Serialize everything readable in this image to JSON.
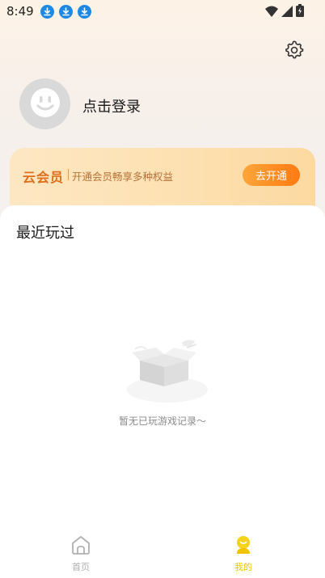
{
  "status_bar": {
    "time": "8:49",
    "icons": [
      "download-icon",
      "download-icon",
      "download-icon",
      "wifi-icon",
      "signal-icon",
      "battery-icon"
    ]
  },
  "header": {
    "settings_icon": "gear-icon"
  },
  "profile": {
    "avatar_icon": "smiley-avatar-icon",
    "login_label": "点击登录"
  },
  "member_card": {
    "title": "云会员",
    "description": "开通会员畅享多种权益",
    "button_label": "去开通"
  },
  "recent": {
    "title": "最近玩过",
    "empty_icon": "empty-box-icon",
    "empty_text": "暂无已玩游戏记录～"
  },
  "tab_bar": {
    "tabs": [
      {
        "label": "首页",
        "icon": "home-icon",
        "active": false
      },
      {
        "label": "我的",
        "icon": "profile-tab-icon",
        "active": true
      }
    ],
    "active_color": "#f2c400",
    "inactive_color": "#b0b0b0"
  },
  "colors": {
    "accent_orange": "#ff7b12",
    "member_title": "#e06d1b",
    "download_badge": "#1e88e5"
  }
}
